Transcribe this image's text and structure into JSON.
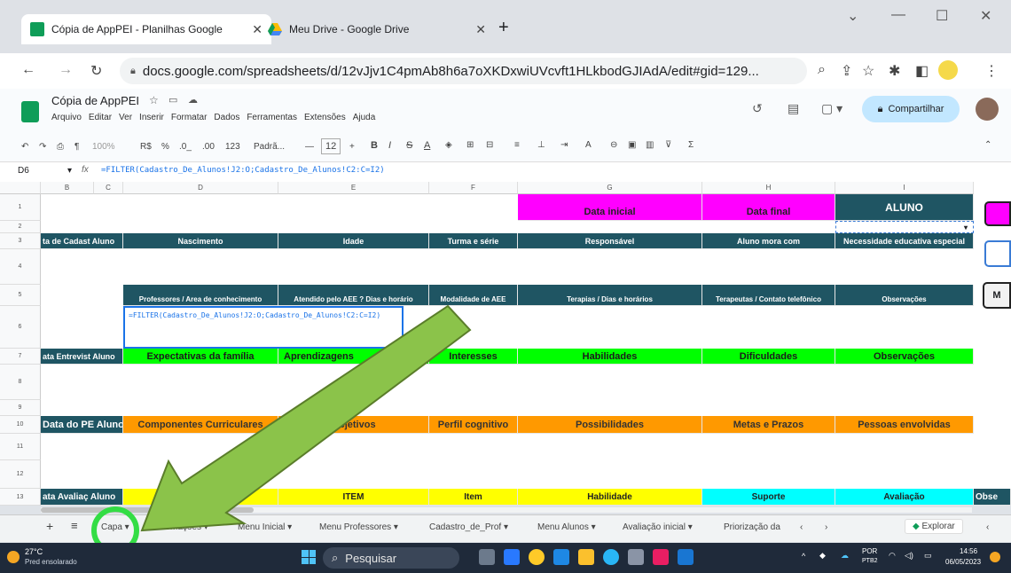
{
  "browser": {
    "tabs": [
      {
        "title": "Cópia de AppPEI - Planilhas Google",
        "close": "✕"
      },
      {
        "title": "Meu Drive - Google Drive",
        "close": "✕"
      }
    ],
    "new_tab": "+",
    "url": "docs.google.com/spreadsheets/d/12vJjv1C4pmAb8h6a7oXKDxwiUVcvft1HLkbodGJIAdA/edit#gid=129...",
    "window_controls": {
      "minimize": "—",
      "maximize": "☐",
      "close": "✕",
      "dropdown": "⌄"
    }
  },
  "sheets": {
    "doc_title": "Cópia de AppPEI",
    "menus": [
      "Arquivo",
      "Editar",
      "Ver",
      "Inserir",
      "Formatar",
      "Dados",
      "Ferramentas",
      "Extensões",
      "Ajuda"
    ],
    "share_label": "Compartilhar",
    "toolbar": {
      "zoom": "100%",
      "currency": "R$",
      "percent": "%",
      "dec_minus": ".0_",
      "dec_plus": ".00",
      "numfmt": "123",
      "font": "Padrã...",
      "font_size": "12"
    },
    "cell_ref": "D6",
    "formula": "=FILTER(Cadastro_De_Alunos!J2:O;Cadastro_De_Alunos!C2:C=I2)",
    "col_headers": [
      "B",
      "C",
      "D",
      "E",
      "F",
      "G",
      "H",
      "I"
    ],
    "row_headers": [
      "1",
      "2",
      "3",
      "4",
      "5",
      "6",
      "7",
      "8",
      "9",
      "10",
      "11",
      "12",
      "13"
    ],
    "cells": {
      "g1": "Data inicial",
      "h1": "Data final",
      "i1": "ALUNO",
      "b3": "ta de Cadast Aluno",
      "d3": "Nascimento",
      "e3": "Idade",
      "f3": "Turma e série",
      "g3": "Responsável",
      "h3": "Aluno mora com",
      "i3": "Necessidade educativa especial",
      "d5": "Professores / Area de conhecimento",
      "e5": "Atendido pelo AEE ? Dias e horário",
      "f5": "Modalidade de AEE",
      "g5": "Terapias / Dias e horários",
      "h5": "Terapeutas / Contato telefônico",
      "i5": "Observações",
      "d6": "=FILTER(Cadastro_De_Alunos!J2:O;Cadastro_De_Alunos!C2:C=I2)",
      "b7": "ata Entrevist Aluno",
      "d7": "Expectativas da família",
      "e7": "Aprendizagens",
      "f7": "Interesses",
      "g7": "Habilidades",
      "h7": "Dificuldades",
      "i7": "Observações",
      "b10": "Data do PE Aluno",
      "d10": "Componentes Curriculares",
      "e10": "Objetivos",
      "f10": "Perfil cognitivo",
      "g10": "Possibilidades",
      "h10": "Metas e Prazos",
      "i10": "Pessoas envolvidas",
      "b13": "ata Avaliaç Aluno",
      "e13": "ITEM",
      "f13": "Item",
      "g13": "Habilidade",
      "h13": "Suporte",
      "i13": "Avaliação",
      "j13": "Obse",
      "j3": "M"
    },
    "sheet_tabs": [
      "Capa",
      "Informações",
      "Menu Inicial",
      "Menu Professores",
      "Cadastro_de_Prof",
      "Menu Alunos",
      "Avaliação inicial",
      "Priorização da"
    ],
    "explore_label": "Explorar"
  },
  "taskbar": {
    "weather_temp": "27°C",
    "weather_desc": "Pred ensolarado",
    "search_placeholder": "Pesquisar",
    "lang": "POR",
    "lang2": "PTB2",
    "time": "14:56",
    "date": "06/05/2023"
  },
  "colors": {
    "arrow": "#8bc34a",
    "circle": "#33dd44"
  }
}
